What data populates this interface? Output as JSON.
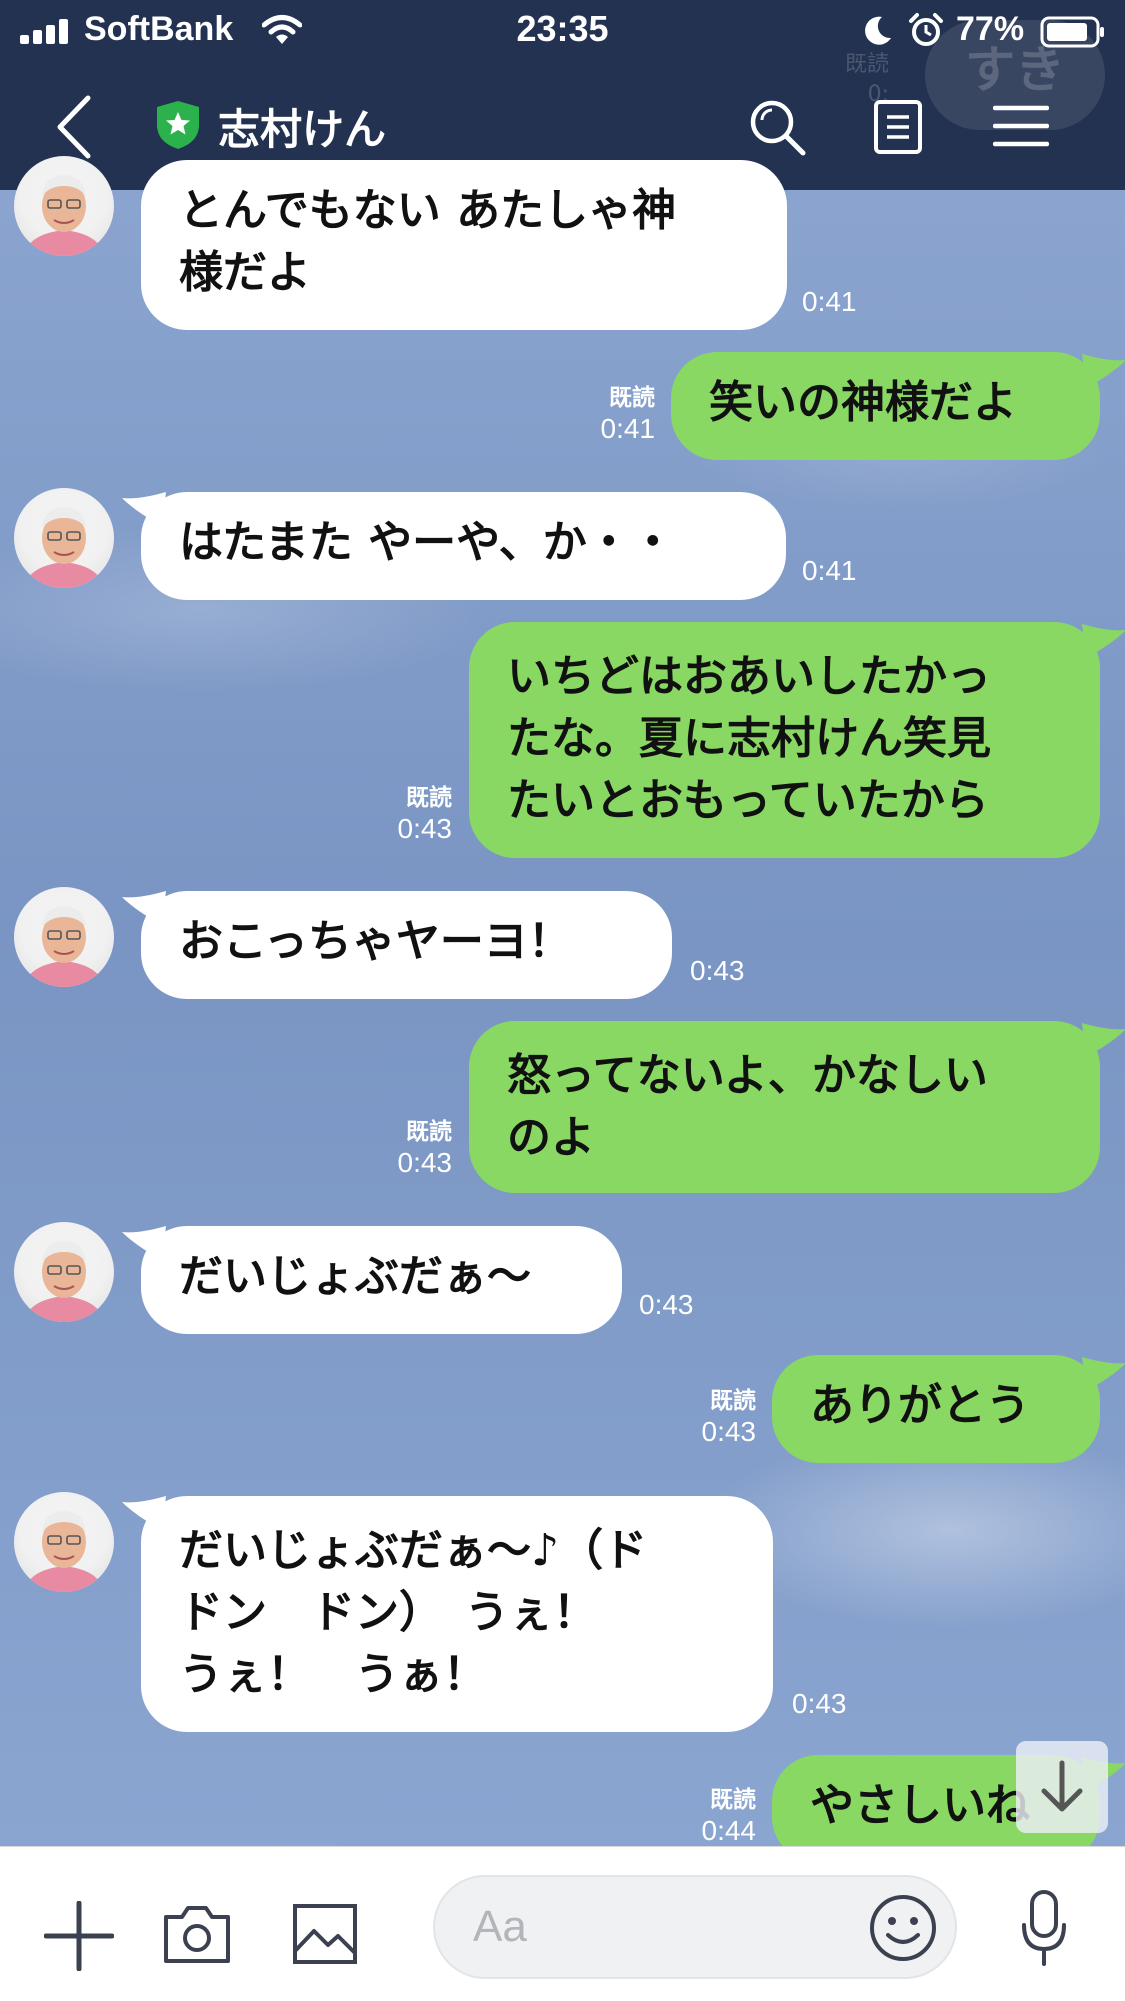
{
  "status_bar": {
    "carrier": "SoftBank",
    "time": "23:35",
    "battery_percent": "77%"
  },
  "header": {
    "title": "志村けん",
    "ghost_badge": "すき",
    "ghost_read": "既読",
    "ghost_read_time": "0:",
    "icons": [
      "back-icon",
      "official-shield-icon",
      "search-icon",
      "notes-icon",
      "menu-icon"
    ]
  },
  "messages": [
    {
      "side": "in",
      "text": "とんでもない あたしゃ神\n様だよ",
      "time": "0:41"
    },
    {
      "side": "out",
      "text": "笑いの神様だよ",
      "read": "既読",
      "time": "0:41"
    },
    {
      "side": "in",
      "text": "はたまた やーや、か・・",
      "time": "0:41"
    },
    {
      "side": "out",
      "text": "いちどはおあいしたかっ\nたな。夏に志村けん笑見\nたいとおもっていたから",
      "read": "既読",
      "time": "0:43"
    },
    {
      "side": "in",
      "text": "おこっちゃヤーヨ！",
      "time": "0:43"
    },
    {
      "side": "out",
      "text": "怒ってないよ、かなしい\nのよ",
      "read": "既読",
      "time": "0:43"
    },
    {
      "side": "in",
      "text": "だいじょぶだぁ〜",
      "time": "0:43"
    },
    {
      "side": "out",
      "text": "ありがとう",
      "read": "既読",
      "time": "0:43"
    },
    {
      "side": "in",
      "text": "だいじょぶだぁ〜♪（ド\nドン　ドン）　うぇ！\nうぇ！　うぁ！",
      "time": "0:43"
    },
    {
      "side": "out",
      "text": "やさしいね",
      "read": "既読",
      "time": "0:44"
    }
  ],
  "input_bar": {
    "placeholder": "Aa",
    "icons": [
      "plus-icon",
      "camera-icon",
      "image-icon",
      "emoji-icon",
      "microphone-icon"
    ]
  },
  "colors": {
    "header_bg": "#233251",
    "outgoing_bubble": "#89d863",
    "incoming_bubble": "#ffffff",
    "official_badge": "#2bb24c"
  }
}
